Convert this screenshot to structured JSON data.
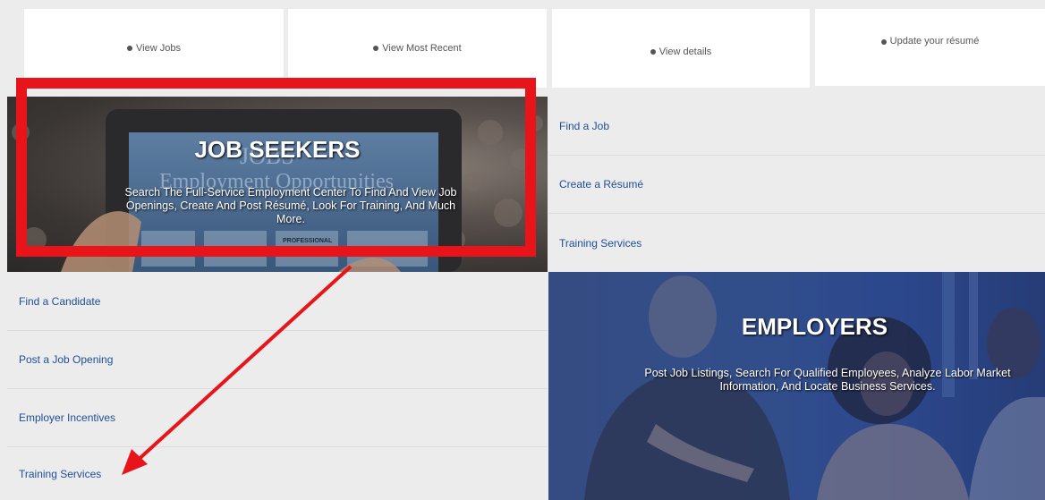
{
  "top_links": [
    {
      "label": "View Jobs"
    },
    {
      "label": "View Most Recent"
    },
    {
      "label": "View details"
    },
    {
      "label": "Update your résumé"
    }
  ],
  "job_seekers": {
    "title": "JOB SEEKERS",
    "description": "Search The Full-Service Employment Center To Find And View Job Openings, Create And Post Résumé, Look For Training, And Much More.",
    "background_text": {
      "line1": "JOBS",
      "line2": "Employment Opportunities",
      "line3": "PROFESSIONAL"
    },
    "links": [
      {
        "label": "Find a Job"
      },
      {
        "label": "Create a Résumé"
      },
      {
        "label": "Training Services"
      }
    ]
  },
  "employers": {
    "title": "EMPLOYERS",
    "description": "Post Job Listings, Search For Qualified Employees, Analyze Labor Market Information, And Locate Business Services.",
    "links": [
      {
        "label": "Find a Candidate"
      },
      {
        "label": "Post a Job Opening"
      },
      {
        "label": "Employer Incentives"
      },
      {
        "label": "Training Services"
      }
    ]
  },
  "colors": {
    "link": "#1f4e96",
    "annotation": "#e8141a",
    "employers_overlay": "#2e4a86"
  }
}
